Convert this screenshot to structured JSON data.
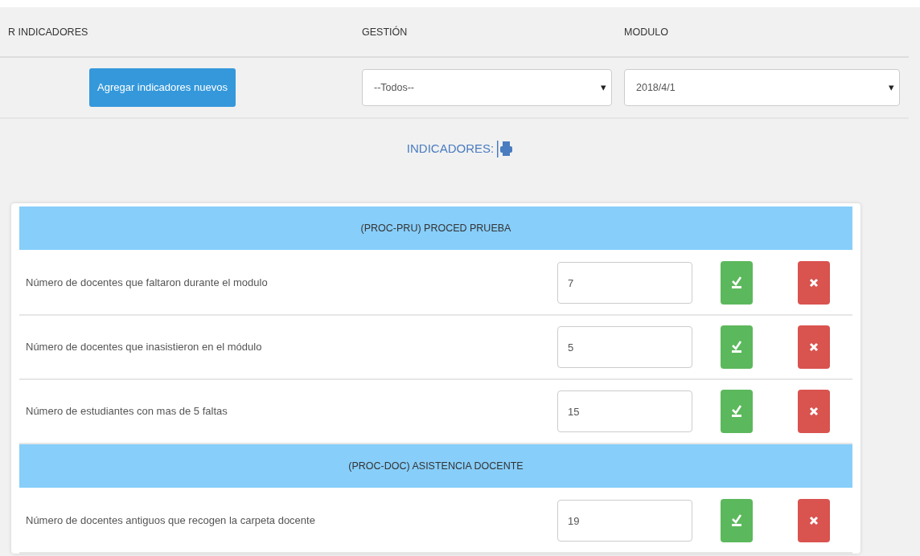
{
  "header": {
    "columns": [
      "R INDICADORES",
      "GESTIÓN",
      "MODULO"
    ]
  },
  "toolbar": {
    "add_button": "Agregar indicadores nuevos",
    "gestion_select": {
      "value": "--Todos--",
      "caret": "▾"
    },
    "modulo_select": {
      "value": "2018/4/1",
      "caret": "▾"
    }
  },
  "section_title": "INDICADORES:",
  "groups": [
    {
      "title": "(PROC-PRU) PROCED PRUEBA",
      "rows": [
        {
          "label": "Número de docentes que faltaron durante el modulo",
          "value": "7"
        },
        {
          "label": "Número de docentes que inasistieron en el módulo",
          "value": "5"
        },
        {
          "label": "Número de estudiantes con mas de 5 faltas",
          "value": "15"
        }
      ]
    },
    {
      "title": "(PROC-DOC) ASISTENCIA DOCENTE",
      "rows": [
        {
          "label": "Número de docentes antiguos que recogen la carpeta docente",
          "value": "19"
        }
      ]
    }
  ]
}
